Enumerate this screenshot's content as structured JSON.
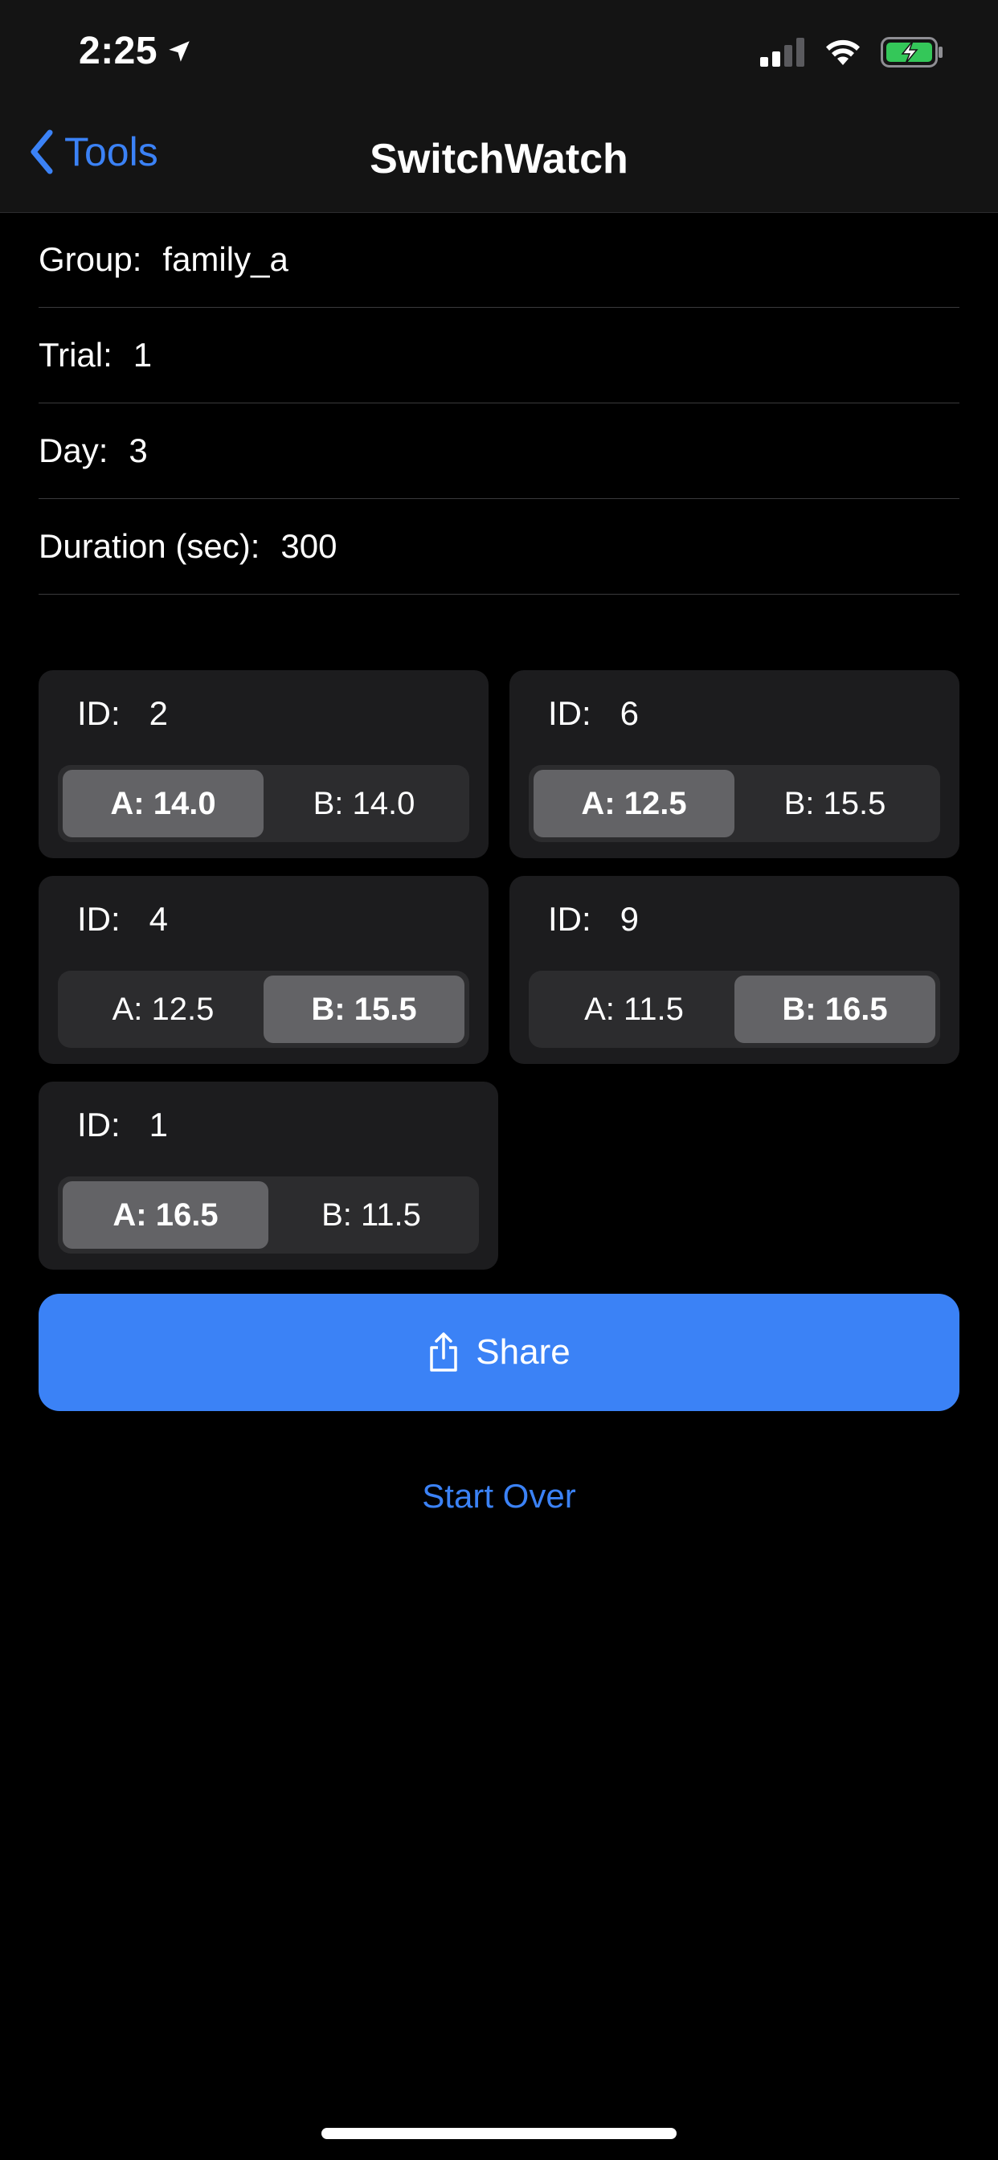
{
  "status_bar": {
    "time": "2:25",
    "icons": [
      "location-arrow-icon",
      "cellular-signal-icon",
      "wifi-icon",
      "battery-charging-icon"
    ],
    "battery_color": "#34c759"
  },
  "nav": {
    "back_label": "Tools",
    "title": "SwitchWatch"
  },
  "info": [
    {
      "label": "Group:",
      "value": "family_a"
    },
    {
      "label": "Trial:",
      "value": "1"
    },
    {
      "label": "Day:",
      "value": "3"
    },
    {
      "label": "Duration (sec):",
      "value": "300"
    }
  ],
  "subjects": [
    {
      "id_label": "ID:",
      "id": "2",
      "a": "A: 14.0",
      "b": "B: 14.0",
      "selected": "A"
    },
    {
      "id_label": "ID:",
      "id": "6",
      "a": "A: 12.5",
      "b": "B: 15.5",
      "selected": "A"
    },
    {
      "id_label": "ID:",
      "id": "4",
      "a": "A: 12.5",
      "b": "B: 15.5",
      "selected": "B"
    },
    {
      "id_label": "ID:",
      "id": "9",
      "a": "A: 11.5",
      "b": "B: 16.5",
      "selected": "B"
    },
    {
      "id_label": "ID:",
      "id": "1",
      "a": "A: 16.5",
      "b": "B: 11.5",
      "selected": "A"
    }
  ],
  "actions": {
    "share_label": "Share",
    "share_icon": "share-icon",
    "start_over_label": "Start Over"
  },
  "colors": {
    "accent": "#3b82f6",
    "background": "#000000",
    "card": "#1c1c1e",
    "segment_selected": "#636366"
  }
}
